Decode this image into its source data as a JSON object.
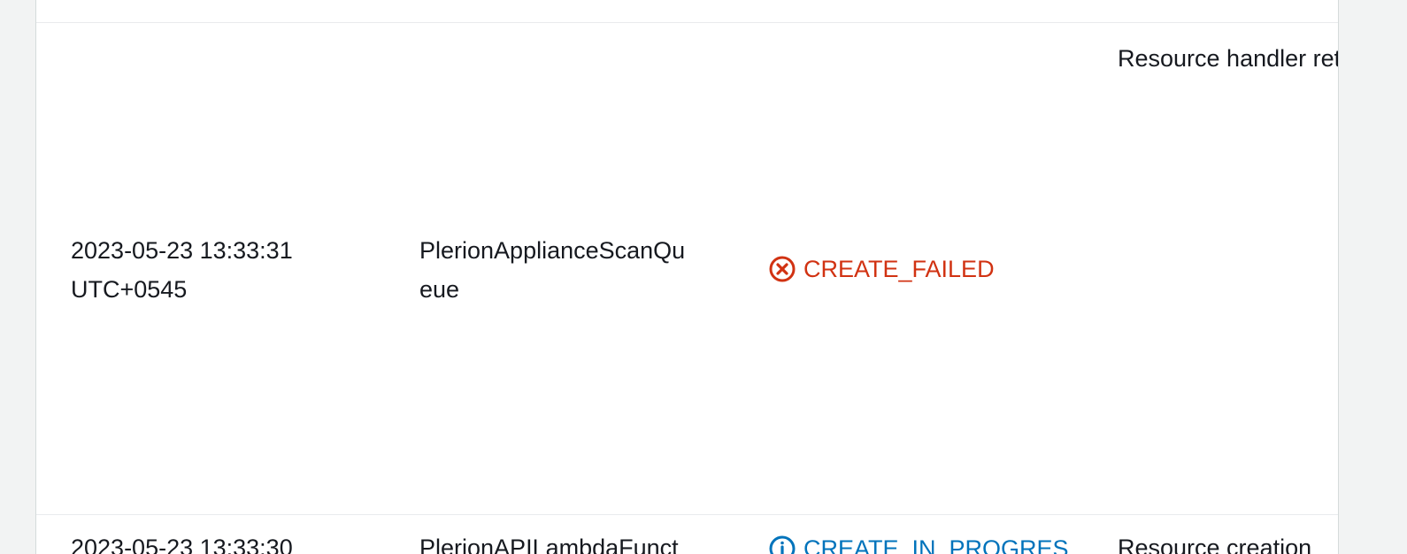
{
  "events": [
    {
      "timestamp": "2023-05-23 13:33:31\nUTC+0545",
      "logical_id": "PlerionApplianceScanQu\neue",
      "status": "CREATE_FAILED",
      "status_kind": "error",
      "status_icon": "error-circle-icon",
      "reason": "Resource handler\nreturned message:\n\"Resource of type\n'AWS::SQS::Queue' w\nidentifier 'plerion-\nappliance-scan-queu\nalready exists.\"\n(RequestToken:\n9cc73458-8744-bd1\nab53-33a79b287b6\nHandlerErrorCode:\nAlreadyExists)"
    },
    {
      "timestamp": "2023-05-23 13:33:30",
      "logical_id": "PlerionAPILambdaFunct",
      "status": "CREATE_IN_PROGRES",
      "status_kind": "info",
      "status_icon": "info-circle-icon",
      "reason": "Resource creation"
    }
  ],
  "colors": {
    "error": "#d13212",
    "info": "#0073bb",
    "text": "#16191f",
    "divider": "#e9ebed",
    "panel_border": "#d5dbdb"
  }
}
